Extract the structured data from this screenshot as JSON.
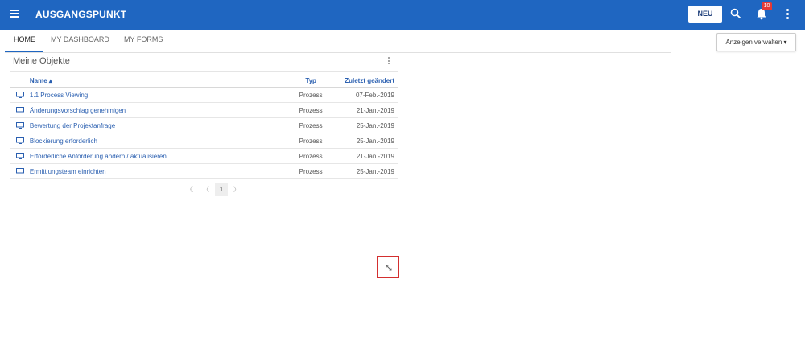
{
  "app": {
    "title": "AUSGANGSPUNKT",
    "new_label": "NEU",
    "notification_count": "10"
  },
  "tabs": [
    "HOME",
    "MY DASHBOARD",
    "MY FORMS"
  ],
  "manage_view": {
    "label": "Anzeigen verwalten ▾"
  },
  "card": {
    "title": "Meine Objekte",
    "headers": {
      "name": "Name ▴",
      "type": "Typ",
      "date": "Zuletzt geändert"
    },
    "rows": [
      {
        "name": "1.1 Process Viewing",
        "type": "Prozess",
        "date": "07-Feb.-2019"
      },
      {
        "name": "Änderungsvorschlag genehmigen",
        "type": "Prozess",
        "date": "21-Jan.-2019"
      },
      {
        "name": "Bewertung der Projektanfrage",
        "type": "Prozess",
        "date": "25-Jan.-2019"
      },
      {
        "name": "Blockierung erforderlich",
        "type": "Prozess",
        "date": "25-Jan.-2019"
      },
      {
        "name": "Erforderliche Anforderung ändern / aktualisieren",
        "type": "Prozess",
        "date": "21-Jan.-2019"
      },
      {
        "name": "Ermittlungsteam einrichten",
        "type": "Prozess",
        "date": "25-Jan.-2019"
      }
    ],
    "pagination": {
      "first": "《",
      "prev": "〈",
      "page": "1",
      "next": "〉"
    }
  },
  "colors": {
    "topbar": "#1f66c1",
    "link": "#2a5fb0",
    "highlight": "#d32f2f"
  },
  "icons": [
    "menu-icon",
    "search-icon",
    "bell-icon",
    "more-vertical-icon",
    "monitor-icon",
    "resize-icon"
  ]
}
